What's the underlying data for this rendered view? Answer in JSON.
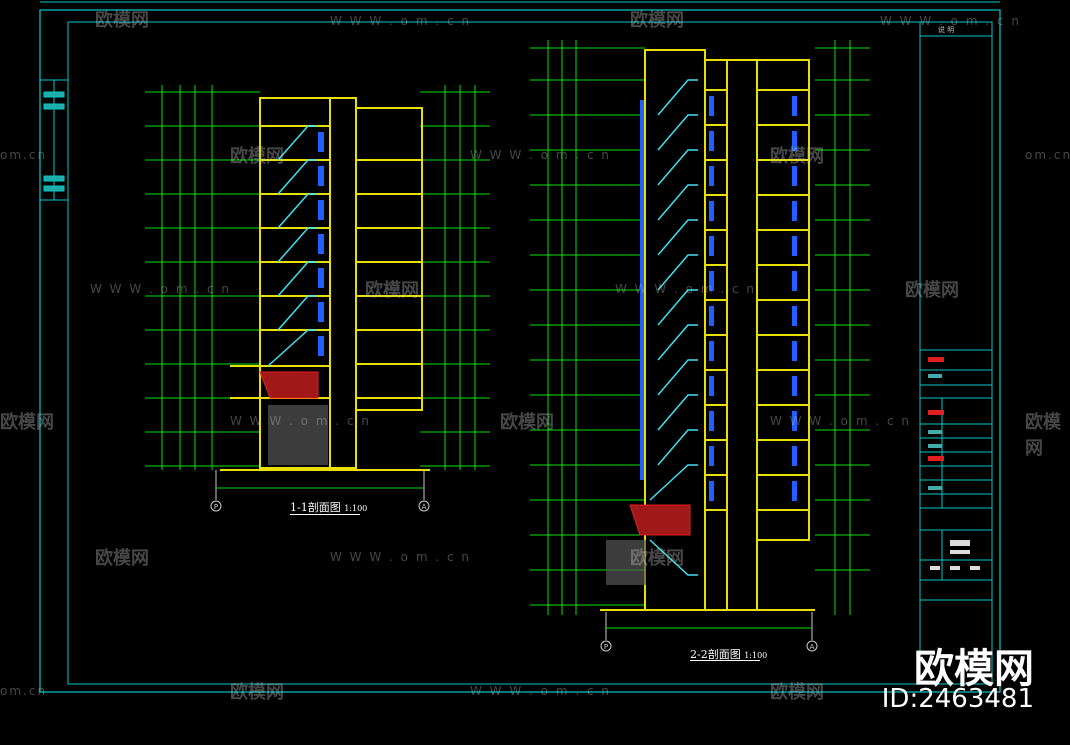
{
  "sections": {
    "section1_title": "1-1剖面图",
    "section1_scale": "1:100",
    "section2_title": "2-2剖面图",
    "section2_scale": "1:100",
    "axis_left": "P",
    "axis_right": "A"
  },
  "titleblock": {
    "header": "说 明"
  },
  "watermark": {
    "url": "W W W . o m . c n",
    "url_short": "om.cn",
    "brand": "欧模网",
    "brand_big": "欧模网",
    "id": "ID:2463481"
  },
  "colors": {
    "background": "#000000",
    "frame": "#00d0d0",
    "wall": "#e8e000",
    "stair": "#40e0f0",
    "dim": "#00e000",
    "window": "#2060ff",
    "hatch_red": "#d02020"
  }
}
